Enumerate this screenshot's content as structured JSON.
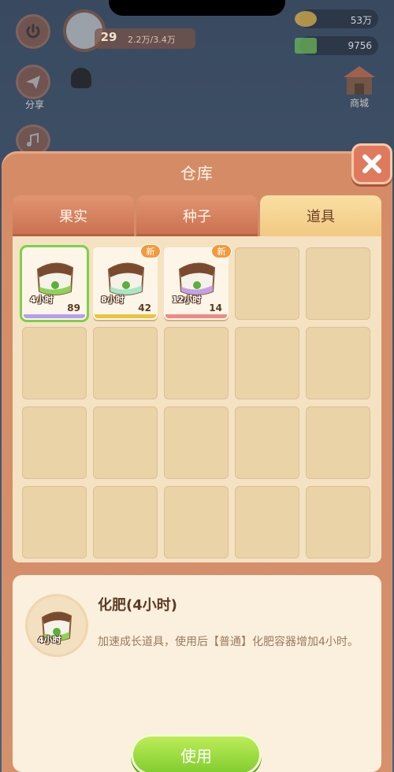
{
  "hud": {
    "share_label": "分享",
    "level": "29",
    "exp": "2.2万/3.4万",
    "coins": "53万",
    "cash": "9756",
    "shop_label": "商城"
  },
  "panel": {
    "title": "仓库",
    "tabs": [
      {
        "label": "果实"
      },
      {
        "label": "种子"
      },
      {
        "label": "道具"
      }
    ],
    "active_tab": "道具"
  },
  "items": [
    {
      "hours": "4小时",
      "count": "89",
      "bar_color": "#b89df0",
      "new": "",
      "selected": true
    },
    {
      "hours": "8小时",
      "count": "42",
      "bar_color": "#e7c540",
      "new": "新",
      "selected": false
    },
    {
      "hours": "12小时",
      "count": "14",
      "bar_color": "#f08a84",
      "new": "新",
      "selected": false
    }
  ],
  "detail": {
    "title": "化肥(4小时)",
    "icon_hours": "4小时",
    "description": "加速成长道具，使用后【普通】化肥容器增加4小时。",
    "use_label": "使用"
  },
  "colors": {
    "accent_green": "#7fcf49",
    "panel": "#d58c66",
    "tab_active": "#f1c982"
  }
}
